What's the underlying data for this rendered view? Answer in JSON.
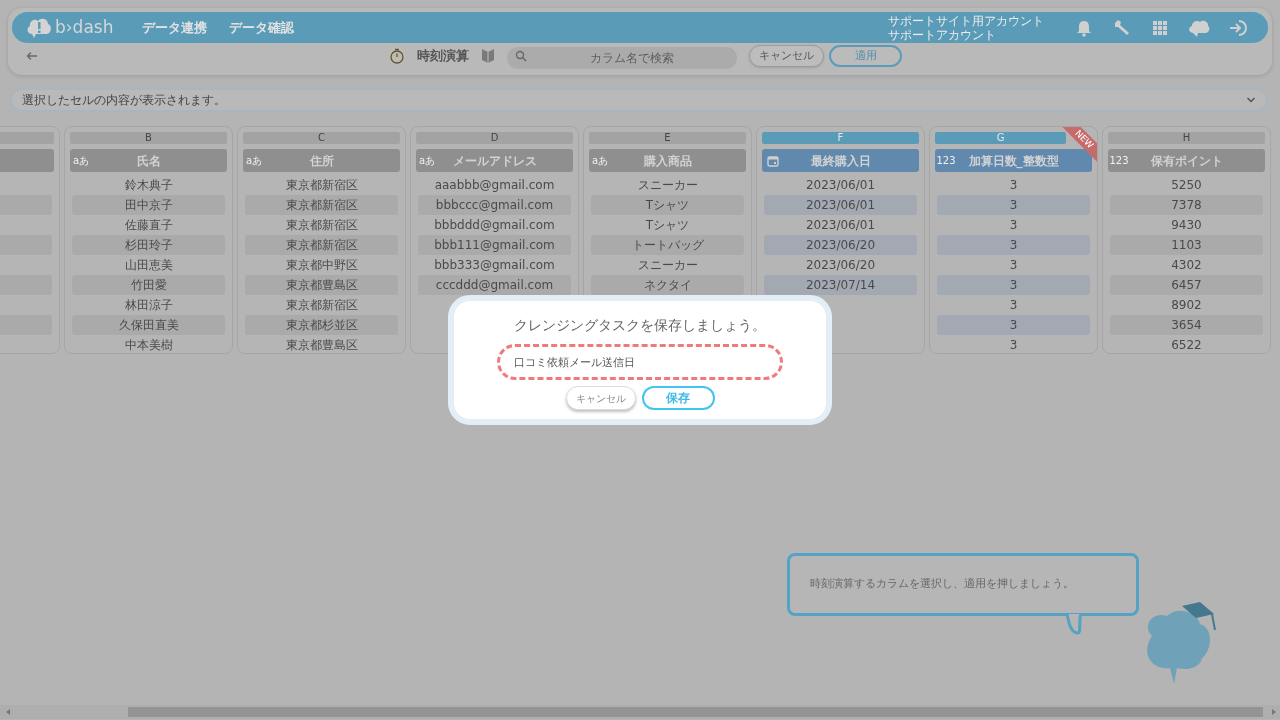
{
  "header": {
    "logo_text": "b›dash",
    "nav": [
      "データ連携",
      "データ確認"
    ],
    "account_lines": [
      "サポートサイト用アカウント",
      "サポートアカウント"
    ]
  },
  "toolbar": {
    "feature_title": "時刻演算",
    "search": {
      "placeholder": "カラム名で検索"
    },
    "buttons": [
      {
        "kind": "cancel",
        "label": "キャンセル"
      },
      {
        "kind": "apply",
        "label": "適用"
      }
    ]
  },
  "info_bar": {
    "text": "選択したセルの内容が表示されます。"
  },
  "columns": [
    {
      "selected": false
    },
    {
      "letter": "B",
      "kind": "text",
      "type_label": "aあ",
      "title": "氏名",
      "selected": false,
      "cells": [
        "鈴木典子",
        "田中京子",
        "佐藤直子",
        "杉田玲子",
        "山田恵美",
        "竹田愛",
        "林田涼子",
        "久保田直美",
        "中本美樹"
      ]
    },
    {
      "letter": "C",
      "kind": "text",
      "type_label": "aあ",
      "title": "住所",
      "selected": false,
      "cells": [
        "東京都新宿区",
        "東京都新宿区",
        "東京都新宿区",
        "東京都新宿区",
        "東京都中野区",
        "東京都豊島区",
        "東京都新宿区",
        "東京都杉並区",
        "東京都豊島区"
      ]
    },
    {
      "letter": "D",
      "kind": "text",
      "type_label": "aあ",
      "title": "メールアドレス",
      "selected": false,
      "cells": [
        "aaabbb@gmail.com",
        "bbbccc@gmail.com",
        "bbbddd@gmail.com",
        "bbb111@gmail.com",
        "bbb333@gmail.com",
        "cccddd@gmail.com",
        null,
        null,
        null
      ]
    },
    {
      "letter": "E",
      "kind": "text",
      "type_label": "aあ",
      "title": "購入商品",
      "selected": false,
      "cells": [
        "スニーカー",
        "Tシャツ",
        "Tシャツ",
        "トートバッグ",
        "スニーカー",
        "ネクタイ",
        null,
        null,
        null
      ]
    },
    {
      "letter": "F",
      "kind": "date",
      "title": "最終購入日",
      "selected": true,
      "cells": [
        "2023/06/01",
        "2023/06/01",
        "2023/06/01",
        "2023/06/20",
        "2023/06/20",
        "2023/07/14",
        null,
        null,
        null
      ]
    },
    {
      "letter": "G",
      "kind": "number",
      "type_label": "123",
      "title": "加算日数_整数型",
      "selected": true,
      "badge": "NEW",
      "cells": [
        "3",
        "3",
        "3",
        "3",
        "3",
        "3",
        "3",
        "3",
        "3"
      ]
    },
    {
      "letter": "H",
      "kind": "number",
      "type_label": "123",
      "title": "保有ポイント",
      "selected": false,
      "cells": [
        "5250",
        "7378",
        "9430",
        "1103",
        "4302",
        "6457",
        "8902",
        "3654",
        "6522"
      ]
    }
  ],
  "dialog": {
    "title": "クレンジングタスクを保存しましょう。",
    "input_value": "口コミ依頼メール送信日",
    "buttons": [
      {
        "kind": "cancel",
        "label": "キャンセル"
      },
      {
        "kind": "save",
        "label": "保存"
      }
    ]
  },
  "tutorial": {
    "text": "時刻演算するカラムを選択し、適用を押しましょう。"
  }
}
